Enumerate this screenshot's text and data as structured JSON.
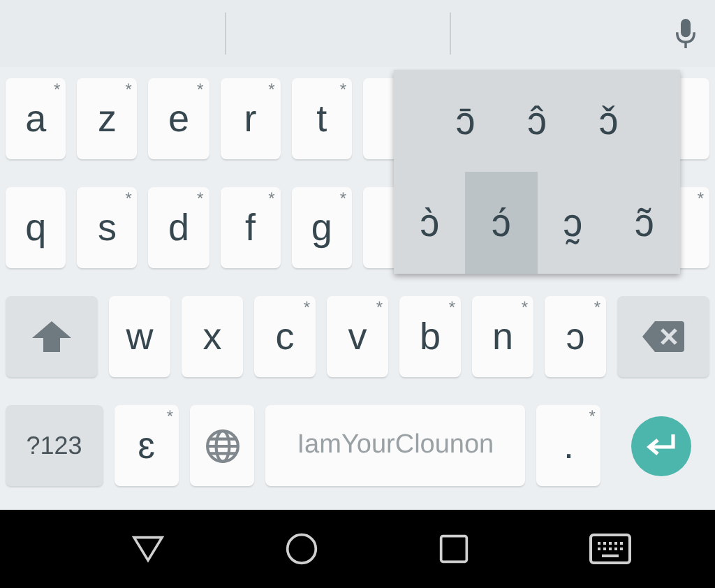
{
  "rows": [
    {
      "keys": [
        {
          "kind": "letter",
          "label": "a",
          "hint": "*"
        },
        {
          "kind": "letter",
          "label": "z",
          "hint": "*"
        },
        {
          "kind": "letter",
          "label": "e",
          "hint": "*"
        },
        {
          "kind": "letter",
          "label": "r",
          "hint": "*"
        },
        {
          "kind": "letter",
          "label": "t",
          "hint": "*"
        },
        {
          "kind": "partial"
        },
        {
          "kind": "covered"
        },
        {
          "kind": "covered"
        },
        {
          "kind": "covered"
        },
        {
          "kind": "partial"
        }
      ]
    },
    {
      "keys": [
        {
          "kind": "letter",
          "label": "q"
        },
        {
          "kind": "letter",
          "label": "s",
          "hint": "*"
        },
        {
          "kind": "letter",
          "label": "d",
          "hint": "*"
        },
        {
          "kind": "letter",
          "label": "f",
          "hint": "*"
        },
        {
          "kind": "letter",
          "label": "g",
          "hint": "*"
        },
        {
          "kind": "partial"
        },
        {
          "kind": "covered"
        },
        {
          "kind": "covered"
        },
        {
          "kind": "covered"
        },
        {
          "kind": "partial",
          "hint": "*"
        }
      ]
    },
    {
      "keys": [
        {
          "kind": "shift"
        },
        {
          "kind": "letter",
          "label": "w"
        },
        {
          "kind": "letter",
          "label": "x"
        },
        {
          "kind": "letter",
          "label": "c",
          "hint": "*"
        },
        {
          "kind": "letter",
          "label": "v",
          "hint": "*"
        },
        {
          "kind": "letter",
          "label": "b",
          "hint": "*"
        },
        {
          "kind": "letter",
          "label": "n",
          "hint": "*"
        },
        {
          "kind": "letter",
          "label": "ɔ",
          "hint": "*"
        },
        {
          "kind": "backspace"
        }
      ]
    },
    {
      "keys": [
        {
          "kind": "symbols",
          "label": "?123"
        },
        {
          "kind": "letter",
          "label": "ɛ",
          "hint": "*"
        },
        {
          "kind": "globe"
        },
        {
          "kind": "space",
          "label": "IamYourClounon"
        },
        {
          "kind": "letter",
          "label": ".",
          "hint": "*"
        },
        {
          "kind": "enter"
        }
      ]
    }
  ],
  "popup": {
    "rows": [
      [
        {
          "label": "ɔ̄",
          "selected": false
        },
        {
          "label": "ɔ̂",
          "selected": false
        },
        {
          "label": "ɔ̌",
          "selected": false
        }
      ],
      [
        {
          "label": "ɔ̀",
          "selected": false
        },
        {
          "label": "ɔ́",
          "selected": true
        },
        {
          "label": "ɔ̰",
          "selected": false
        },
        {
          "label": "ɔ̃",
          "selected": false
        }
      ]
    ]
  },
  "nav_bar": {
    "buttons": [
      {
        "kind": "back"
      },
      {
        "kind": "home"
      },
      {
        "kind": "recents"
      },
      {
        "kind": "keyboard"
      }
    ]
  }
}
